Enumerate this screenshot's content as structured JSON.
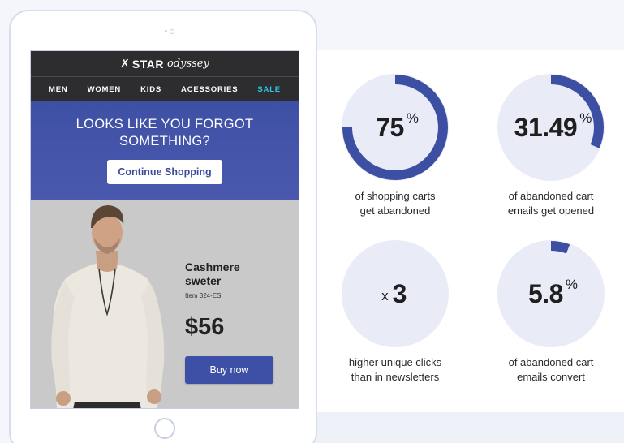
{
  "email": {
    "brand": {
      "star": "✗",
      "name": "STAR",
      "script": "odyssey"
    },
    "nav": [
      {
        "label": "MEN"
      },
      {
        "label": "WOMEN"
      },
      {
        "label": "KIDS"
      },
      {
        "label": "ACESSORIES"
      },
      {
        "label": "SALE",
        "color": "#2ec6e0"
      }
    ],
    "hero": {
      "title_line1": "LOOKS LIKE YOU FORGOT",
      "title_line2": "SOMETHING?",
      "cta": "Continue Shopping"
    },
    "product": {
      "title_line1": "Cashmere",
      "title_line2": "sweter",
      "sku": "Item 324-ES",
      "price": "$56",
      "buy_label": "Buy now",
      "image_icon": "model-photo"
    }
  },
  "stats": [
    {
      "value": "75",
      "suffix": "%",
      "prefix": "",
      "fill_fraction": 0.75,
      "caption_line1": "of shopping carts",
      "caption_line2": "get abandoned"
    },
    {
      "value": "31.49",
      "suffix": "%",
      "prefix": "",
      "fill_fraction": 0.3149,
      "caption_line1": "of abandoned cart",
      "caption_line2": "emails get opened"
    },
    {
      "value": "3",
      "suffix": "",
      "prefix": "x",
      "fill_fraction": 0,
      "caption_line1": "higher unique clicks",
      "caption_line2": "than in newsletters"
    },
    {
      "value": "5.8",
      "suffix": "%",
      "prefix": "",
      "fill_fraction": 0.058,
      "caption_line1": "of abandoned cart",
      "caption_line2": "emails convert"
    }
  ],
  "colors": {
    "accent": "#3e50a5",
    "ring_track": "#e9ebf7",
    "ring_fill": "#3c4fa2",
    "sale": "#2ec6e0"
  }
}
